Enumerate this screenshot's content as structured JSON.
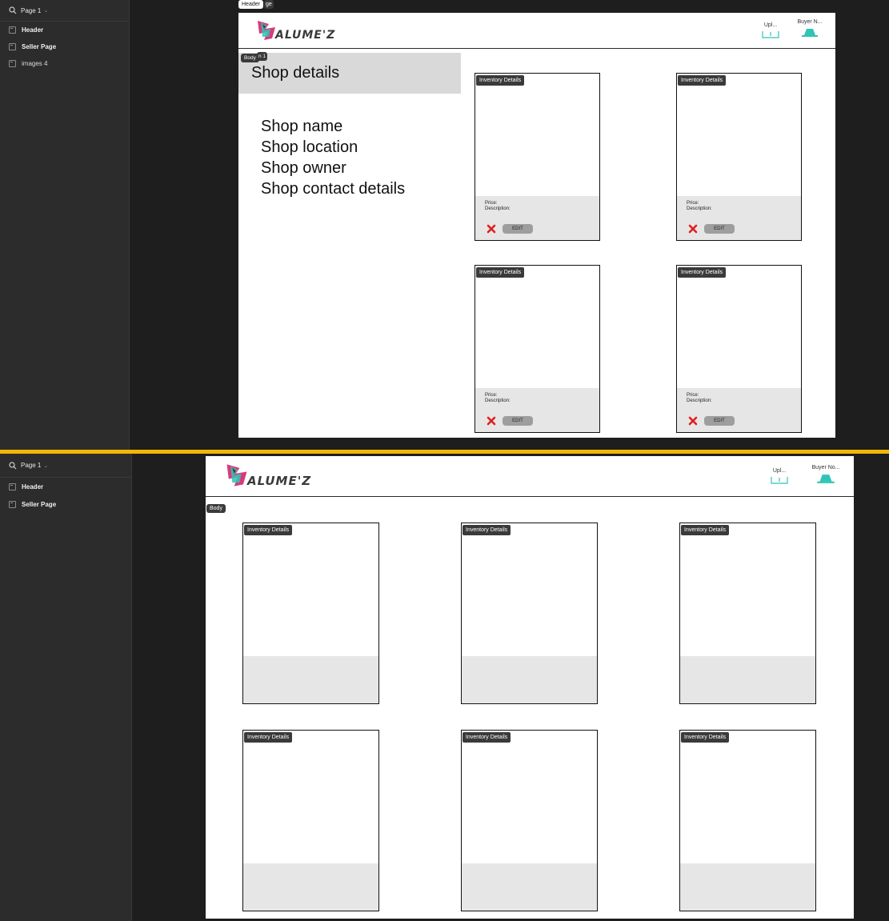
{
  "sidebar_top": {
    "page_label": "Page 1",
    "layers": [
      {
        "label": "Header"
      },
      {
        "label": "Seller Page"
      },
      {
        "label": "images 4"
      }
    ]
  },
  "sidebar_bottom": {
    "page_label": "Page 1",
    "layers": [
      {
        "label": "Header"
      },
      {
        "label": "Seller Page"
      }
    ]
  },
  "frame_tags": {
    "header": "Header",
    "seller_page_fragment": "ge",
    "body": "Body",
    "shop_fragment": "n 1"
  },
  "header": {
    "logo_text": "ALUME'Z",
    "upload_label_top": "Upl...",
    "buyer_label_top": "Buyer N...",
    "upload_label_bottom": "Upl...",
    "buyer_label_bottom": "Buyer No..."
  },
  "shop": {
    "title": "Shop details",
    "lines": [
      "Shop name",
      "Shop location",
      "Shop owner",
      "Shop contact details"
    ]
  },
  "card": {
    "tag": "Inventory Details",
    "price_label": "Price:",
    "description_label": "Description:",
    "edit_label": "EDIT"
  },
  "colors": {
    "accent_teal": "#2ec4b6",
    "delete_red": "#e01e1e",
    "pane_divider": "#f2b705"
  },
  "icons": {
    "upload": "upload-tray-icon",
    "notification": "bell-icon",
    "delete": "close-x-icon",
    "search": "search-icon",
    "frame": "frame-icon"
  }
}
